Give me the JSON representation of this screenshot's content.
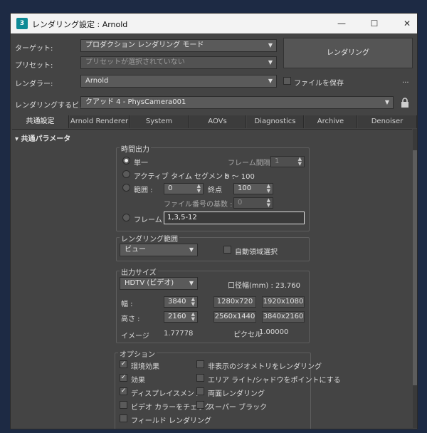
{
  "window": {
    "title": "レンダリング設定 : Arnold",
    "app_icon": "3",
    "minimize": "—",
    "maximize": "☐",
    "close": "✕"
  },
  "top": {
    "target_label": "ターゲット:",
    "target_value": "プロダクション レンダリング モード",
    "preset_label": "プリセット:",
    "preset_value": "プリセットが選択されていない",
    "renderer_label": "レンダラー:",
    "renderer_value": "Arnold",
    "save_file_label": "ファイルを保存",
    "more": "...",
    "render_button": "レンダリング",
    "view_label": "レンダリングするビュー:",
    "view_value": "クアッド 4 - PhysCamera001"
  },
  "tabs": [
    "共通設定",
    "Arnold Renderer",
    "System",
    "AOVs",
    "Diagnostics",
    "Archive",
    "Denoiser"
  ],
  "common": {
    "rollout_title": "▾ 共通パラメータ",
    "time_output": {
      "title": "時間出力",
      "single": "単一",
      "frame_interval_label": "フレーム間隔 :",
      "frame_interval_value": "1",
      "active_segment": "アクティブ タイム セグメント :",
      "active_segment_range": "0 〜 100",
      "range": "範囲 :",
      "range_start": "0",
      "range_end_label": "終点",
      "range_end": "100",
      "file_number_base_label": "ファイル番号の基数 :",
      "file_number_base_value": "0",
      "frames": "フレーム :",
      "frames_value": "1,3,5-12"
    },
    "render_area": {
      "title": "レンダリング範囲",
      "value": "ビュー",
      "auto_region": "自動領域選択"
    },
    "output_size": {
      "title": "出力サイズ",
      "preset": "HDTV (ビデオ)",
      "aperture": "口径幅(mm) : 23.760",
      "width_label": "幅 :",
      "width_value": "3840",
      "height_label": "高さ :",
      "height_value": "2160",
      "presets": [
        "1280x720",
        "1920x1080",
        "2560x1440",
        "3840x2160"
      ],
      "image_aspect_label": "イメージ",
      "image_aspect_value": "1.77778",
      "pixel_aspect_label": "ピクセル",
      "pixel_aspect_value": "1.00000"
    },
    "options": {
      "title": "オプション",
      "atmospherics": "環境効果",
      "effects": "効果",
      "displacement": "ディスプレイスメント",
      "video_color_check": "ビデオ カラーをチェック",
      "field_render": "フィールド レンダリング",
      "render_hidden": "非表示のジオメトリをレンダリング",
      "area_lights": "エリア ライト/シャドウをポイントにする",
      "two_sided": "両面レンダリング",
      "super_black": "スーパー ブラック",
      "check": "✓"
    }
  }
}
